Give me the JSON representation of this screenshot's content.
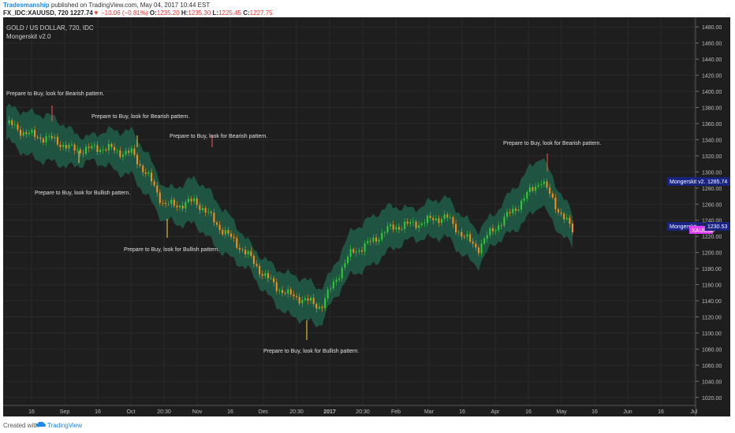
{
  "header": {
    "author": "Tradesmanship",
    "published": " published on TradingView.com, May 04, 2017 10:44 EST",
    "symbol": "FX_IDC:XAUUSD, 720",
    "last": "1227.74",
    "change": "−10.06 (−0.81%)",
    "open_label": "O:",
    "open": "1235.20",
    "high_label": "H:",
    "high": "1235.30",
    "low_label": "L:",
    "low": "1225.45",
    "close_label": "C:",
    "close": "1227.75"
  },
  "legend": {
    "title": "GOLD / US DOLLAR, 720, IDC",
    "indicator": "Mongerskit v2.0"
  },
  "price_axis": {
    "ticks": [
      "1480.00",
      "1460.00",
      "1440.00",
      "1420.00",
      "1400.00",
      "1380.00",
      "1360.00",
      "1340.00",
      "1320.00",
      "1300.00",
      "1280.00",
      "1260.00",
      "1240.00",
      "1220.00",
      "1200.00",
      "1180.00",
      "1160.00",
      "1140.00",
      "1120.00",
      "1100.00",
      "1080.00",
      "1060.00",
      "1040.00",
      "1020.00"
    ],
    "range": [
      1010,
      1490
    ]
  },
  "time_axis": {
    "ticks": [
      "16",
      "Sep",
      "16",
      "Oct",
      "20:30",
      "Nov",
      "16",
      "Dec",
      "20:30",
      "2017",
      "20:30",
      "Feb",
      "Mar",
      "16",
      "Apr",
      "16",
      "May",
      "16",
      "Jun",
      "16",
      "Jul"
    ]
  },
  "badges": {
    "plot_label": "Mongerskit v2.0:Plot",
    "plot_value": "1285.74",
    "plot2_label": "Mongerskit",
    "symbol_tag": "XAUUSD",
    "price_value": "1230.53"
  },
  "annotations": [
    {
      "text": "Prepare to Buy, look for Bearish pattern."
    },
    {
      "text": "Prepare to Buy, look for Bearish pattern."
    },
    {
      "text": "Prepare to Buy, look for Bearish pattern."
    },
    {
      "text": "Prepare to Buy, look for Bearish pattern."
    },
    {
      "text": "Prepare to Buy, look for Bullish pattern."
    },
    {
      "text": "Prepare to Buy, look for Bullish pattern."
    },
    {
      "text": "Prepare to Buy, look for Bullish pattern."
    }
  ],
  "colors": {
    "background": "#1e1e1e",
    "band": "#1f5e48",
    "bull": "#33cc33",
    "bear": "#ff8c1a",
    "plot_badge": "#1a237e",
    "symbol_badge": "#e040fb"
  },
  "chart_data": {
    "type": "line",
    "series_kind": "candlestick with bands",
    "x": [
      "Aug 1",
      "Aug 16",
      "Sep 1",
      "Sep 16",
      "Oct 1",
      "Oct 16",
      "Nov 1",
      "Nov 16",
      "Dec 1",
      "Dec 16",
      "Jan 1",
      "Jan 16",
      "Feb 1",
      "Feb 16",
      "Mar 1",
      "Mar 16",
      "Apr 1",
      "Apr 16",
      "May 4"
    ],
    "series": [
      {
        "values": [
          1358,
          1345,
          1330,
          1328,
          1325,
          1260,
          1262,
          1225,
          1180,
          1145,
          1135,
          1200,
          1225,
          1238,
          1242,
          1205,
          1250,
          1288,
          1228
        ]
      }
    ],
    "ylim": [
      1010,
      1490
    ],
    "grid": true
  },
  "footer": {
    "created": "Created with",
    "brand": "TradingView"
  }
}
